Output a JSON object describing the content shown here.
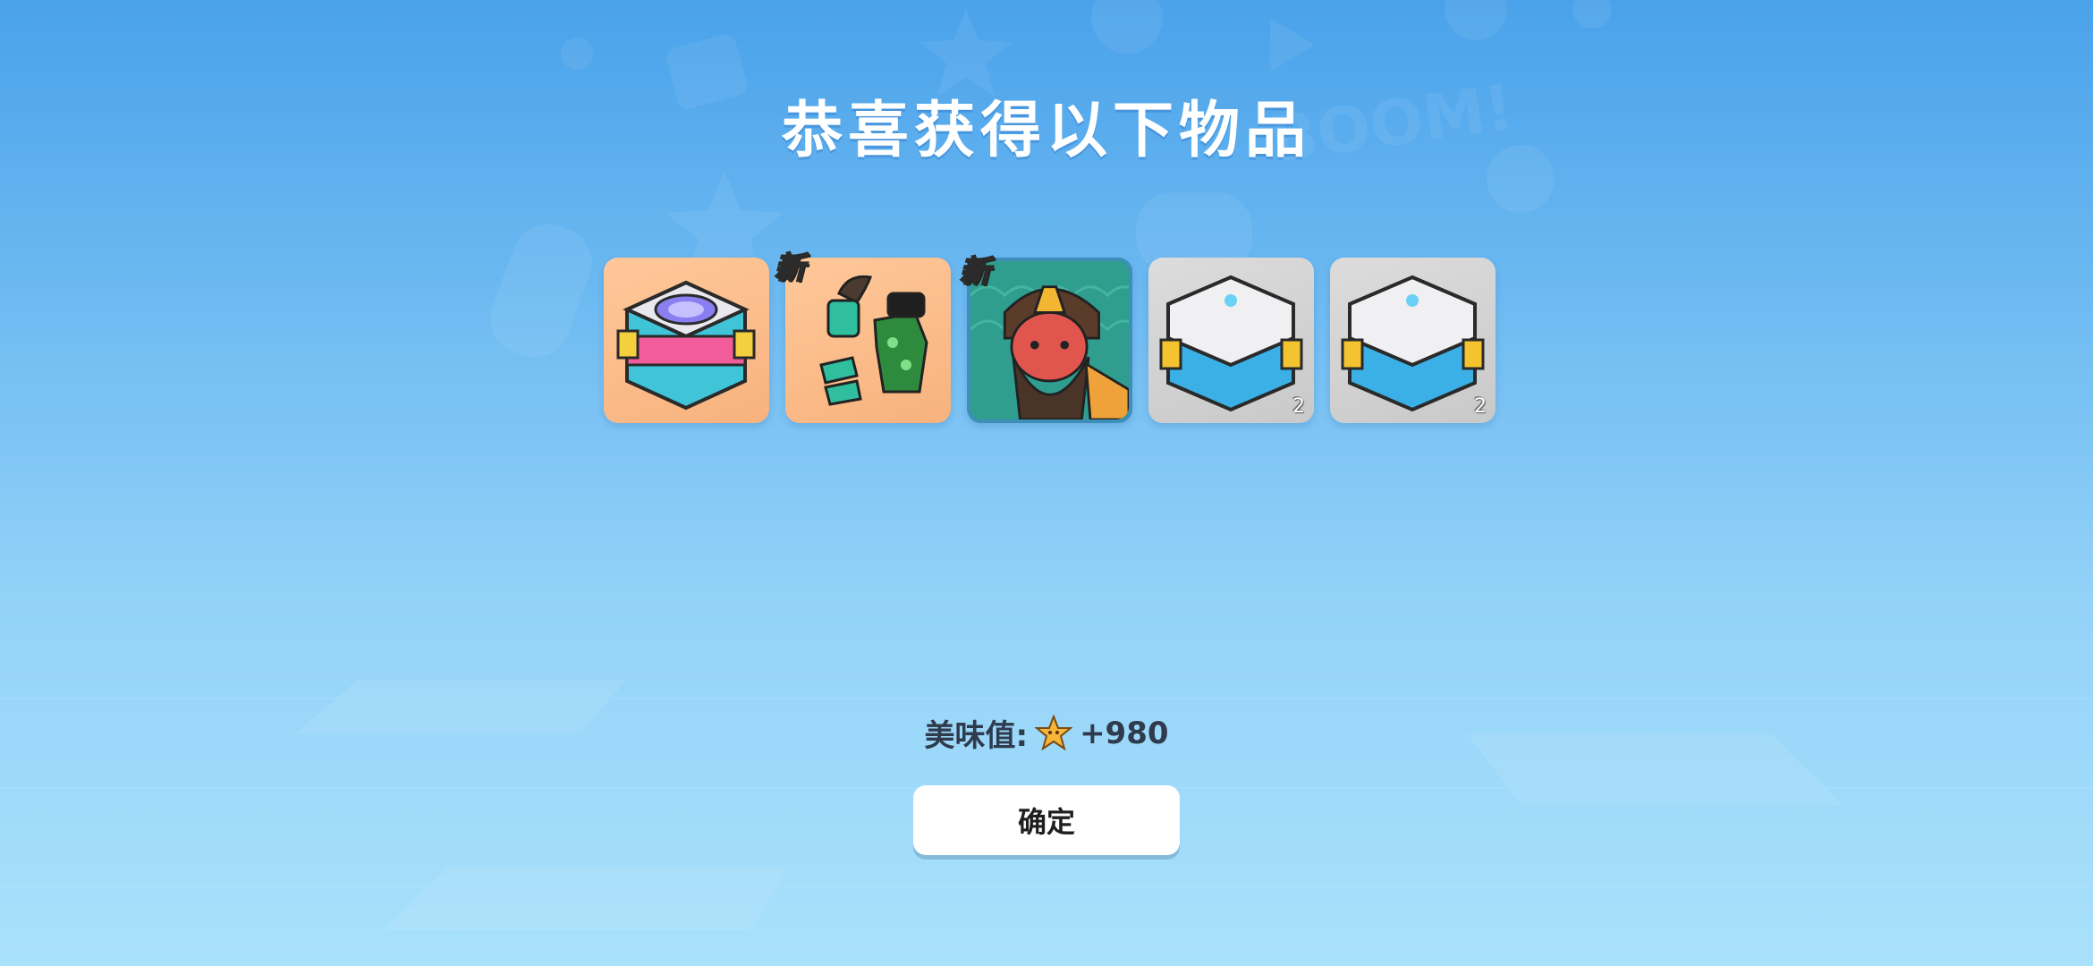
{
  "title": "恭喜获得以下物品",
  "items": [
    {
      "name": "pink-mystery-box",
      "bg": "orange",
      "badge": "",
      "count": ""
    },
    {
      "name": "green-outfit-set",
      "bg": "orange",
      "badge": "新",
      "count": ""
    },
    {
      "name": "bearded-hero-avatar",
      "bg": "teal",
      "badge": "新",
      "count": ""
    },
    {
      "name": "white-blue-box",
      "bg": "gray",
      "badge": "",
      "count": "2"
    },
    {
      "name": "white-blue-box",
      "bg": "gray",
      "badge": "",
      "count": "2"
    }
  ],
  "reward": {
    "label": "美味值:",
    "icon": "star-coin-icon",
    "value": "+980"
  },
  "confirm_label": "确定",
  "colors": {
    "bg_top": "#4aa2ea",
    "bg_bottom": "#a9e1fb",
    "item_orange": "#f7b27d",
    "item_gray": "#cfcfcf",
    "item_teal": "#2f9e8f",
    "badge_yellow": "#ffe14a"
  }
}
